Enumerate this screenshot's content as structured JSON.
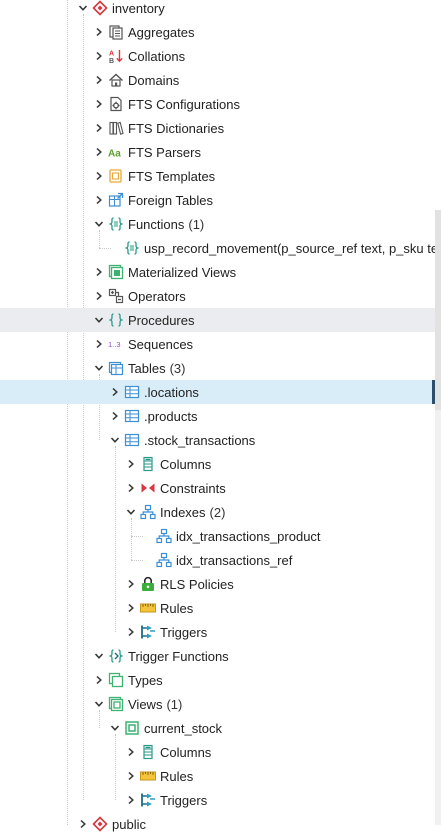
{
  "colors": {
    "accent": "#2c4f6e",
    "selected_bg": "#d8edf8",
    "hover_bg": "#eaecef",
    "icon_green": "#3cb371",
    "icon_blue": "#3a8fd6",
    "icon_red": "#d9363e",
    "icon_purple": "#8a4fd0"
  },
  "tree": [
    {
      "name": "inventory",
      "state": "expanded",
      "icon": "schema-icon"
    },
    {
      "name": "Aggregates",
      "state": "collapsed",
      "icon": "aggregates-icon"
    },
    {
      "name": "Collations",
      "state": "collapsed",
      "icon": "collations-icon"
    },
    {
      "name": "Domains",
      "state": "collapsed",
      "icon": "domains-icon"
    },
    {
      "name": "FTS Configurations",
      "state": "collapsed",
      "icon": "fts-configurations-icon"
    },
    {
      "name": "FTS Dictionaries",
      "state": "collapsed",
      "icon": "fts-dictionaries-icon"
    },
    {
      "name": "FTS Parsers",
      "state": "collapsed",
      "icon": "fts-parsers-icon"
    },
    {
      "name": "FTS Templates",
      "state": "collapsed",
      "icon": "fts-templates-icon"
    },
    {
      "name": "Foreign Tables",
      "state": "collapsed",
      "icon": "foreign-tables-icon"
    },
    {
      "name": "Functions",
      "count": "(1)",
      "state": "expanded",
      "icon": "functions-icon"
    },
    {
      "name": "usp_record_movement(p_source_ref text, p_sku text, p_location text, p_quantity integer)",
      "state": "leaf",
      "icon": "function-icon"
    },
    {
      "name": "Materialized Views",
      "state": "collapsed",
      "icon": "materialized-views-icon"
    },
    {
      "name": "Operators",
      "state": "collapsed",
      "icon": "operators-icon"
    },
    {
      "name": "Procedures",
      "state": "expanded",
      "icon": "procedures-icon"
    },
    {
      "name": "Sequences",
      "state": "collapsed",
      "icon": "sequences-icon"
    },
    {
      "name": "Tables",
      "count": "(3)",
      "state": "expanded",
      "icon": "tables-icon"
    },
    {
      "name": ".locations",
      "state": "collapsed",
      "icon": "table-icon"
    },
    {
      "name": ".products",
      "state": "collapsed",
      "icon": "table-icon"
    },
    {
      "name": ".stock_transactions",
      "state": "expanded",
      "icon": "table-icon"
    },
    {
      "name": "Columns",
      "state": "collapsed",
      "icon": "columns-icon"
    },
    {
      "name": "Constraints",
      "state": "collapsed",
      "icon": "constraints-icon"
    },
    {
      "name": "Indexes",
      "count": "(2)",
      "state": "expanded",
      "icon": "indexes-icon"
    },
    {
      "name": "idx_transactions_product",
      "state": "leaf",
      "icon": "index-icon"
    },
    {
      "name": "idx_transactions_ref",
      "state": "leaf",
      "icon": "index-icon"
    },
    {
      "name": "RLS Policies",
      "state": "collapsed",
      "icon": "rls-policies-icon"
    },
    {
      "name": "Rules",
      "state": "collapsed",
      "icon": "rules-icon"
    },
    {
      "name": "Triggers",
      "state": "collapsed",
      "icon": "triggers-icon"
    },
    {
      "name": "Trigger Functions",
      "state": "expanded",
      "icon": "trigger-functions-icon"
    },
    {
      "name": "Types",
      "state": "collapsed",
      "icon": "types-icon"
    },
    {
      "name": "Views",
      "count": "(1)",
      "state": "expanded",
      "icon": "views-icon"
    },
    {
      "name": "current_stock",
      "state": "expanded",
      "icon": "view-icon"
    },
    {
      "name": "Columns",
      "state": "collapsed",
      "icon": "columns-icon"
    },
    {
      "name": "Rules",
      "state": "collapsed",
      "icon": "rules-icon"
    },
    {
      "name": "Triggers",
      "state": "collapsed",
      "icon": "triggers-icon"
    },
    {
      "name": "public",
      "state": "collapsed",
      "icon": "schema-icon"
    }
  ]
}
